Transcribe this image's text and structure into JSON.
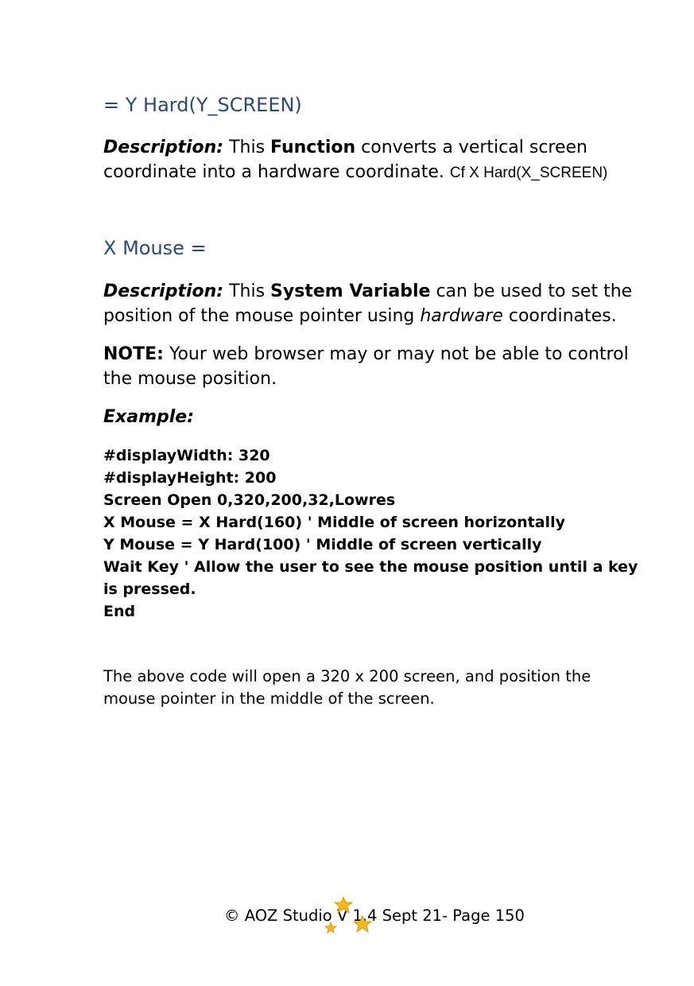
{
  "sections": {
    "yhard": {
      "heading": "= Y Hard(Y_SCREEN)",
      "desc_label": "Description:",
      "desc_pre": " This ",
      "desc_bold": "Function",
      "desc_post": " converts a vertical screen coordinate into a hardware coordinate. ",
      "desc_cf": "Cf X Hard(X_SCREEN)"
    },
    "xmouse": {
      "heading": "X Mouse =",
      "desc_label": "Description:",
      "desc_pre": " This ",
      "desc_bold": "System Variable",
      "desc_mid": " can be used to set the position of the mouse pointer using ",
      "desc_italic": "hardware",
      "desc_post": " coordinates.",
      "note_label": "NOTE:",
      "note_text": " Your web browser may or may not be able to control the mouse position.",
      "example_label": "Example:",
      "code_lines": [
        "#displayWidth: 320",
        "#displayHeight: 200",
        "Screen Open 0,320,200,32,Lowres",
        "X Mouse = X Hard(160) ' Middle of screen horizontally",
        "Y Mouse = Y Hard(100) ' Middle of screen vertically",
        "Wait Key ' Allow the user to see the mouse position until a key is pressed.",
        "End"
      ],
      "explanation": "The above code will open a 320 x 200 screen, and position the mouse pointer in the middle of the screen."
    }
  },
  "footer": {
    "text": "© AOZ Studio V 1.4 Sept 21- Page 150"
  },
  "colors": {
    "heading": "#2b4a73",
    "star": "#f5b820"
  }
}
